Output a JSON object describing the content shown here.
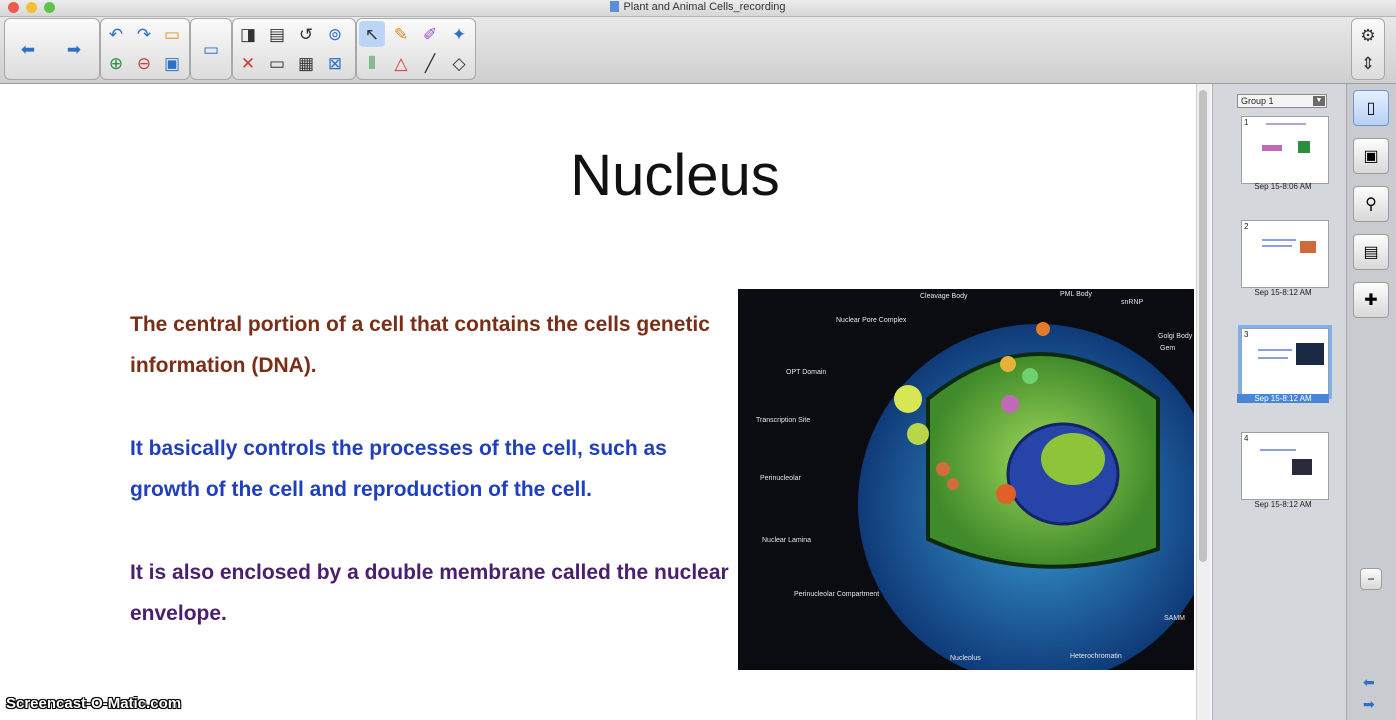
{
  "window": {
    "title": "Plant and Animal Cells_recording"
  },
  "toolbar": {
    "back_icon": "arrow-left-icon",
    "forward_icon": "arrow-right-icon"
  },
  "slide": {
    "title": "Nucleus",
    "paragraphs": [
      "The central portion of a cell that contains the cells genetic information (DNA).",
      "It basically controls the processes of the cell, such as growth of the cell and reproduction of the cell.",
      "It is also enclosed by a double membrane called the nuclear envelope."
    ],
    "colors": {
      "p1": "#7a2e16",
      "p2": "#1f3fbd",
      "p3": "#4a1f6e"
    },
    "image_labels": [
      "Cleavage Body",
      "PML Body",
      "snRNP",
      "Nuclear Pore Complex",
      "Golgi Body",
      "Gem",
      "OPT Domain",
      "Transcription Site",
      "Perinucleolar",
      "Nuclear Lamina",
      "Perinucleolar Compartment",
      "Nucleolus",
      "Heterochromatin",
      "SAMM"
    ]
  },
  "watermark": "Screencast-O-Matic.com",
  "sorter": {
    "group": "Group 1",
    "pages": [
      {
        "num": "1",
        "date": "Sep 15-8:06 AM"
      },
      {
        "num": "2",
        "date": "Sep 15-8:12 AM"
      },
      {
        "num": "3",
        "date": "Sep 15-8:12 AM"
      },
      {
        "num": "4",
        "date": "Sep 15-8:12 AM"
      }
    ]
  }
}
